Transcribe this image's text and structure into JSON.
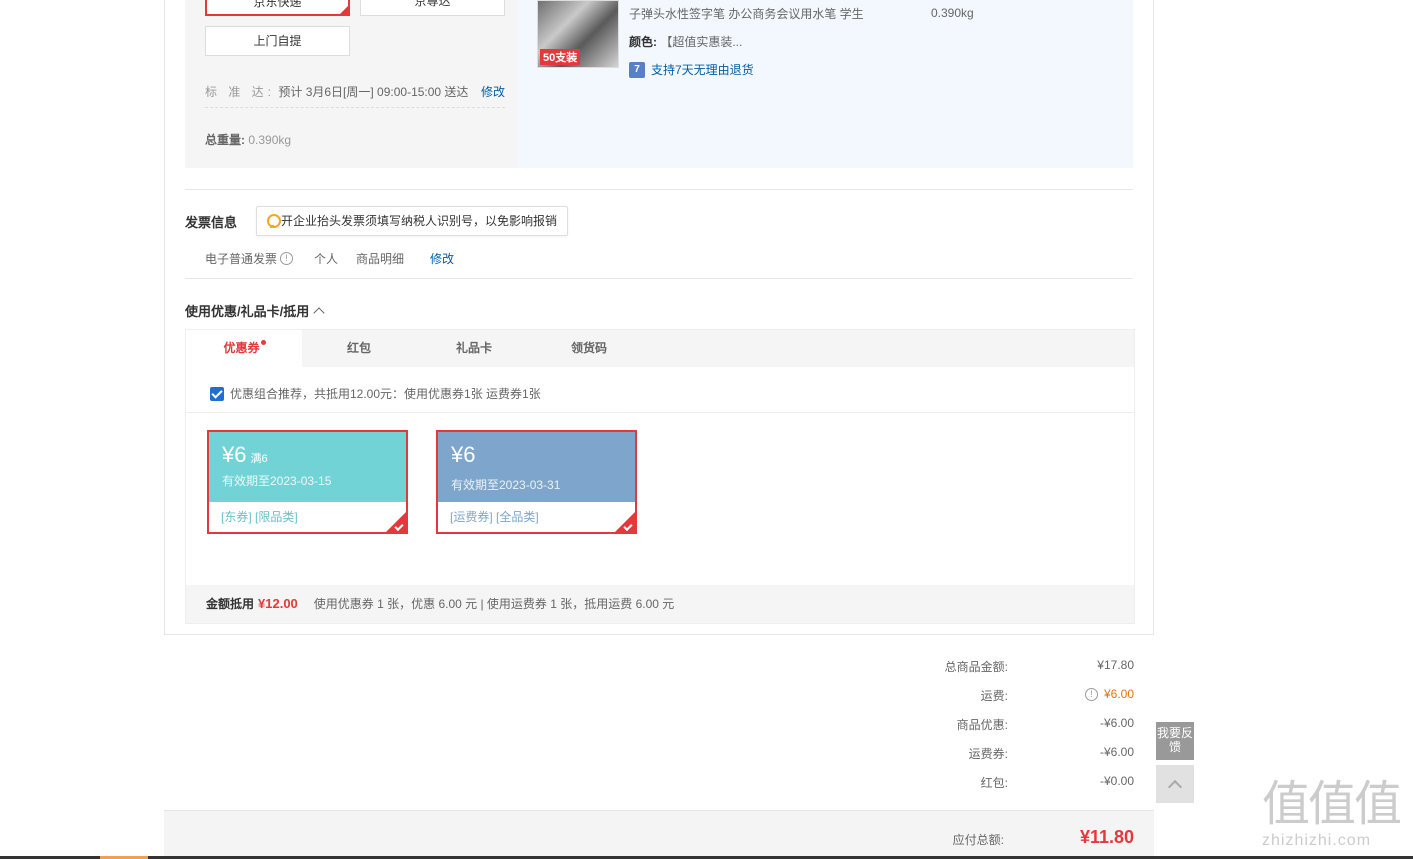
{
  "shipping": {
    "jd_express": "京东快递",
    "jd_wait": "京尊达",
    "pickup": "上门自提",
    "standard_label": "标 准 达:",
    "standard_value": "预计 3月6日[周一] 09:00-15:00 送达",
    "standard_modify": "修改",
    "weight_label": "总重量:",
    "weight_value": "0.390kg"
  },
  "product": {
    "tag": "50支装",
    "name": "子弹头水性签字笔 办公商务会议用水笔 学生",
    "weight": "0.390kg",
    "color_label": "颜色:",
    "color_value": "【超值实惠装...",
    "return_icon": "7",
    "return_text": "支持7天无理由退货"
  },
  "invoice": {
    "title": "发票信息",
    "tip": "开企业抬头发票须填写纳税人识别号，以免影响报销",
    "type": "电子普通发票",
    "info_icon": "!",
    "person": "个人",
    "detail": "商品明细",
    "modify": "修改"
  },
  "coupons": {
    "title": "使用优惠/礼品卡/抵用",
    "tabs": [
      "优惠券",
      "红包",
      "礼品卡",
      "领货码"
    ],
    "recommend": "优惠组合推荐，共抵用12.00元：使用优惠券1张 运费券1张",
    "items": [
      {
        "amount": "¥6",
        "condition": "满6",
        "expiry": "有效期至2023-03-15",
        "tags": "[东券] [限品类]",
        "color": "#72d3d6"
      },
      {
        "amount": "¥6",
        "condition": "",
        "expiry": "有效期至2023-03-31",
        "tags": "[运费券] [全品类]",
        "color": "#7ea6cc"
      }
    ],
    "footer_label": "金额抵用",
    "footer_amount": "¥12.00",
    "footer_detail": "使用优惠券 1 张，优惠 6.00 元 | 使用运费券 1 张，抵用运费 6.00 元"
  },
  "totals": {
    "rows": [
      {
        "label": "总商品金额:",
        "value": "¥17.80"
      },
      {
        "label": "运费:",
        "value": "¥6.00"
      },
      {
        "label": "商品优惠:",
        "value": "-¥6.00"
      },
      {
        "label": "运费券:",
        "value": "-¥6.00"
      },
      {
        "label": "红包:",
        "value": "-¥0.00"
      }
    ],
    "pay_label": "应付总额:",
    "pay_value": "¥11.80"
  },
  "side": {
    "feedback": "我要反馈"
  },
  "watermark": {
    "big": "值值值",
    "small": "zhizhizhi.com"
  }
}
